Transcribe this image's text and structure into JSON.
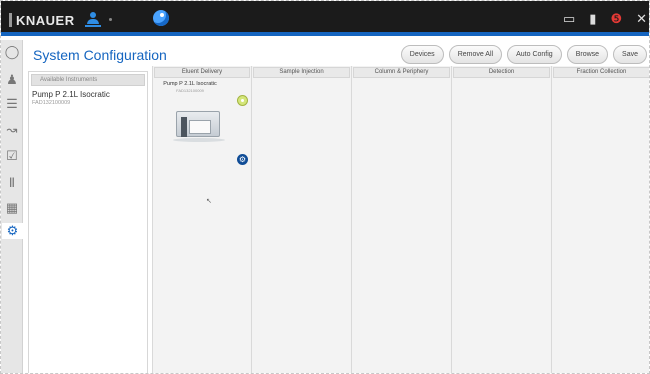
{
  "topbar": {
    "brand": "KNAUER",
    "icons": [
      "user-icon",
      "app-logo-icon",
      "monitor-icon",
      "lock-icon",
      "network-icon",
      "close-icon"
    ]
  },
  "rail": {
    "icons": [
      "home-icon",
      "people-icon",
      "sequence-icon",
      "chart-icon",
      "checkbox-icon",
      "column-icon",
      "report-icon",
      "gear-icon"
    ],
    "active": "gear-icon"
  },
  "header": {
    "title": "System Configuration",
    "buttons": [
      "Devices",
      "Remove All",
      "Auto Config",
      "Browse",
      "Save"
    ]
  },
  "instruments": {
    "heading": "Available Instruments",
    "items": [
      {
        "name": "Pump P 2.1L Isocratic",
        "serial": "FAD132100009"
      }
    ]
  },
  "columns": {
    "headers": [
      "Eluent Delivery",
      "Sample Injection",
      "Column & Periphery",
      "Detection",
      "Fraction Collection"
    ]
  },
  "device_card": {
    "name": "Pump P 2.1L Isocratic",
    "serial": "FAD132100009"
  },
  "colors": {
    "accent": "#1565c0",
    "topbar": "#1b1b1b",
    "add_button": "#d4e67a"
  }
}
